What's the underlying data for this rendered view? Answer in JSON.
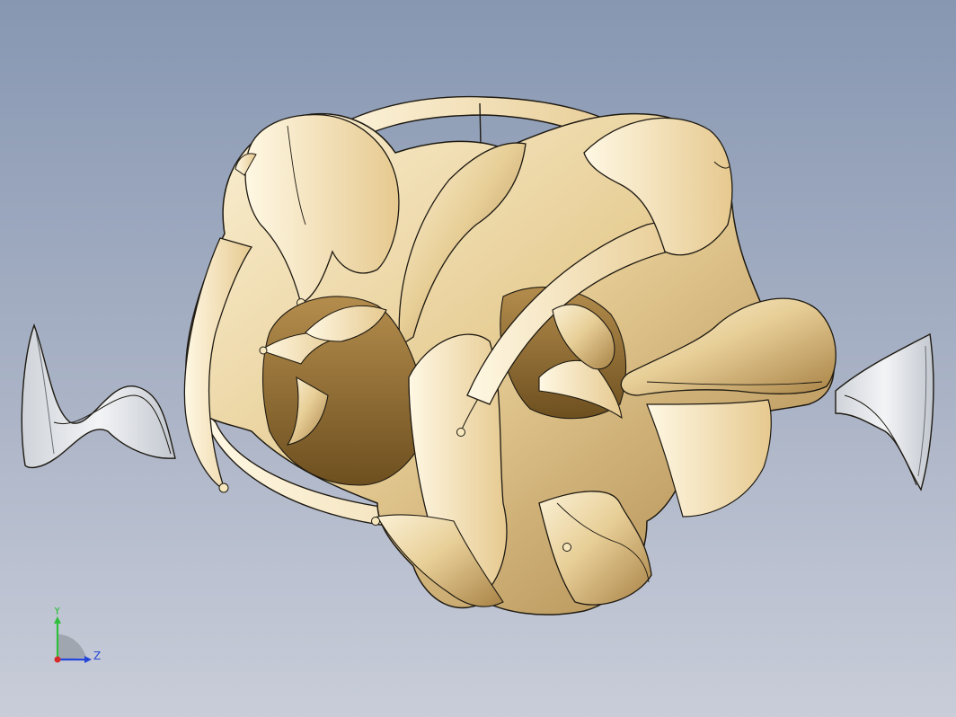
{
  "viewport": {
    "background_top": "#8797b2",
    "background_bottom": "#c9cdd9",
    "model": {
      "name": "sculpted-surface-body",
      "surface_color": "#e8cf98",
      "highlight_color": "#fbf1d6",
      "shadow_color": "#8f6a2c",
      "edge_color": "#1e1a12",
      "fin_color": "#e9ecef"
    },
    "triad": {
      "y_label": "Y",
      "z_label": "Z",
      "y_color": "#2fbf3a",
      "z_color": "#2446d8",
      "x_color": "#d62b2b"
    }
  }
}
